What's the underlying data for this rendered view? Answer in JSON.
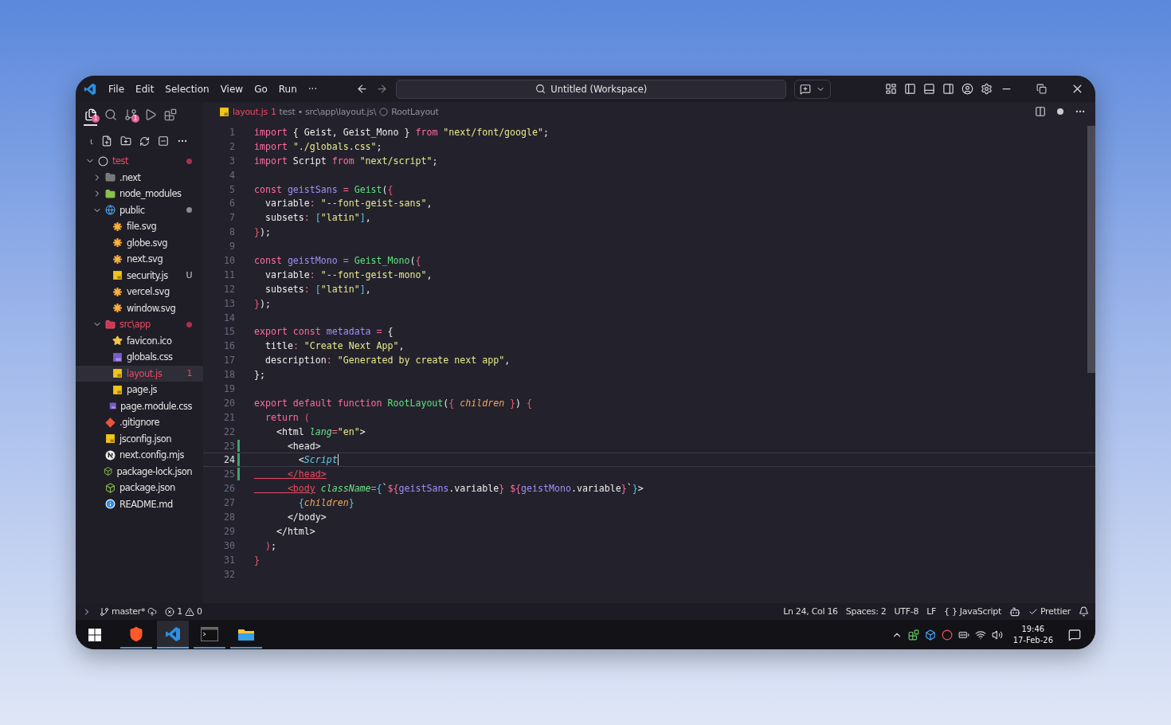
{
  "title_bar": {
    "menus": [
      "File",
      "Edit",
      "Selection",
      "View",
      "Go",
      "Run",
      "···"
    ],
    "search": "Untitled (Workspace)"
  },
  "activity": [
    {
      "kind": "explorer",
      "selected": true,
      "badge": "1"
    },
    {
      "kind": "search",
      "selected": false
    },
    {
      "kind": "source-control",
      "selected": false,
      "badge": "1"
    },
    {
      "kind": "run",
      "selected": false
    },
    {
      "kind": "extensions",
      "selected": false
    }
  ],
  "explorer_tools": {
    "collapse_mark": "ι"
  },
  "tree": [
    {
      "name": "test",
      "kind": "root",
      "error": true,
      "dot": true,
      "selected": false,
      "expanded": true,
      "children": [
        {
          "name": ".next",
          "kind": "folder-next",
          "error": false,
          "dot": false,
          "selected": false,
          "expanded": false
        },
        {
          "name": "node_modules",
          "kind": "folder-node",
          "error": false,
          "dot": false,
          "selected": false,
          "expanded": false
        },
        {
          "name": "public",
          "kind": "folder-public",
          "error": false,
          "dot": true,
          "selected": false,
          "expanded": true,
          "children": [
            {
              "name": "file.svg",
              "kind": "svg",
              "error": false,
              "dot": false,
              "selected": false
            },
            {
              "name": "globe.svg",
              "kind": "svg",
              "error": false,
              "dot": false,
              "selected": false
            },
            {
              "name": "next.svg",
              "kind": "svg",
              "error": false,
              "dot": false,
              "selected": false
            },
            {
              "name": "security.js",
              "kind": "js",
              "error": false,
              "dot": false,
              "selected": false,
              "badge": "U"
            },
            {
              "name": "vercel.svg",
              "kind": "svg",
              "error": false,
              "dot": false,
              "selected": false
            },
            {
              "name": "window.svg",
              "kind": "svg",
              "error": false,
              "dot": false,
              "selected": false
            }
          ]
        },
        {
          "name": "src\\app",
          "kind": "folder-src",
          "error": true,
          "dot": true,
          "selected": false,
          "expanded": true,
          "children": [
            {
              "name": "favicon.ico",
              "kind": "star",
              "error": false,
              "dot": false,
              "selected": false
            },
            {
              "name": "globals.css",
              "kind": "css",
              "error": false,
              "dot": false,
              "selected": false
            },
            {
              "name": "layout.js",
              "kind": "js",
              "error": true,
              "dot": false,
              "selected": true,
              "badge": "1"
            },
            {
              "name": "page.js",
              "kind": "js",
              "error": false,
              "dot": false,
              "selected": false
            },
            {
              "name": "page.module.css",
              "kind": "css",
              "error": false,
              "dot": false,
              "selected": false
            }
          ]
        },
        {
          "name": ".gitignore",
          "kind": "git",
          "error": false,
          "dot": false,
          "selected": false
        },
        {
          "name": "jsconfig.json",
          "kind": "jsconfig",
          "error": false,
          "dot": false,
          "selected": false
        },
        {
          "name": "next.config.mjs",
          "kind": "next",
          "error": false,
          "dot": false,
          "selected": false
        },
        {
          "name": "package-lock.json",
          "kind": "node",
          "error": false,
          "dot": false,
          "selected": false
        },
        {
          "name": "package.json",
          "kind": "node",
          "error": false,
          "dot": false,
          "selected": false
        },
        {
          "name": "README.md",
          "kind": "info",
          "error": false,
          "dot": false,
          "selected": false
        }
      ]
    }
  ],
  "editor": {
    "file": "layout.js",
    "problems": "1",
    "path": "test • src\\app\\layout.js\\",
    "symbol": "RootLayout",
    "dirty": true,
    "lines": [
      {
        "number": "1",
        "current": false,
        "changed": false,
        "tokens": [
          {
            "text": "import",
            "kind": "kw"
          },
          {
            "text": " { Geist, Geist_Mono } ",
            "kind": "plain"
          },
          {
            "text": "from ",
            "kind": "kw"
          },
          {
            "text": "\"next/font/google\"",
            "kind": "str"
          },
          {
            "text": ";",
            "kind": "plain"
          }
        ]
      },
      {
        "number": "2",
        "current": false,
        "changed": false,
        "tokens": [
          {
            "text": "import ",
            "kind": "kw"
          },
          {
            "text": "\"./globals.css\"",
            "kind": "str"
          },
          {
            "text": ";",
            "kind": "plain"
          }
        ]
      },
      {
        "number": "3",
        "current": false,
        "changed": false,
        "tokens": [
          {
            "text": "import",
            "kind": "kw"
          },
          {
            "text": " Script ",
            "kind": "plain"
          },
          {
            "text": "from ",
            "kind": "kw"
          },
          {
            "text": "\"next/script\"",
            "kind": "str"
          },
          {
            "text": ";",
            "kind": "plain"
          }
        ]
      },
      {
        "number": "4",
        "current": false,
        "changed": false
      },
      {
        "number": "5",
        "current": false,
        "changed": false,
        "tokens": [
          {
            "text": "const ",
            "kind": "kw"
          },
          {
            "text": "geistSans",
            "kind": "var"
          },
          {
            "text": " = ",
            "kind": "op"
          },
          {
            "text": "Geist",
            "kind": "fn"
          },
          {
            "text": "(",
            "kind": "plain"
          },
          {
            "text": "{",
            "kind": "brace"
          }
        ]
      },
      {
        "number": "6",
        "current": false,
        "changed": false,
        "tokens": [
          {
            "text": "  variable",
            "kind": "plain"
          },
          {
            "text": ": ",
            "kind": "op"
          },
          {
            "text": "\"--font-geist-sans\"",
            "kind": "str"
          },
          {
            "text": ",",
            "kind": "plain"
          }
        ]
      },
      {
        "number": "7",
        "current": false,
        "changed": false,
        "tokens": [
          {
            "text": "  subsets",
            "kind": "plain"
          },
          {
            "text": ": ",
            "kind": "op"
          },
          {
            "text": "[",
            "kind": "brace2"
          },
          {
            "text": "\"latin\"",
            "kind": "str"
          },
          {
            "text": "]",
            "kind": "brace2"
          },
          {
            "text": ",",
            "kind": "plain"
          }
        ]
      },
      {
        "number": "8",
        "current": false,
        "changed": false,
        "tokens": [
          {
            "text": "}",
            "kind": "brace"
          },
          {
            "text": ");",
            "kind": "plain"
          }
        ]
      },
      {
        "number": "9",
        "current": false,
        "changed": false
      },
      {
        "number": "10",
        "current": false,
        "changed": false,
        "tokens": [
          {
            "text": "const ",
            "kind": "kw"
          },
          {
            "text": "geistMono",
            "kind": "var"
          },
          {
            "text": " = ",
            "kind": "op"
          },
          {
            "text": "Geist_Mono",
            "kind": "fn"
          },
          {
            "text": "(",
            "kind": "plain"
          },
          {
            "text": "{",
            "kind": "brace"
          }
        ]
      },
      {
        "number": "11",
        "current": false,
        "changed": false,
        "tokens": [
          {
            "text": "  variable",
            "kind": "plain"
          },
          {
            "text": ": ",
            "kind": "op"
          },
          {
            "text": "\"--font-geist-mono\"",
            "kind": "str"
          },
          {
            "text": ",",
            "kind": "plain"
          }
        ]
      },
      {
        "number": "12",
        "current": false,
        "changed": false,
        "tokens": [
          {
            "text": "  subsets",
            "kind": "plain"
          },
          {
            "text": ": ",
            "kind": "op"
          },
          {
            "text": "[",
            "kind": "brace2"
          },
          {
            "text": "\"latin\"",
            "kind": "str"
          },
          {
            "text": "]",
            "kind": "brace2"
          },
          {
            "text": ",",
            "kind": "plain"
          }
        ]
      },
      {
        "number": "13",
        "current": false,
        "changed": false,
        "tokens": [
          {
            "text": "}",
            "kind": "brace"
          },
          {
            "text": ");",
            "kind": "plain"
          }
        ]
      },
      {
        "number": "14",
        "current": false,
        "changed": false
      },
      {
        "number": "15",
        "current": false,
        "changed": false,
        "tokens": [
          {
            "text": "export const ",
            "kind": "kw"
          },
          {
            "text": "metadata",
            "kind": "var"
          },
          {
            "text": " = ",
            "kind": "op"
          },
          {
            "text": "{",
            "kind": "plain"
          }
        ]
      },
      {
        "number": "16",
        "current": false,
        "changed": false,
        "tokens": [
          {
            "text": "  title",
            "kind": "plain"
          },
          {
            "text": ": ",
            "kind": "op"
          },
          {
            "text": "\"Create Next App\"",
            "kind": "str"
          },
          {
            "text": ",",
            "kind": "plain"
          }
        ]
      },
      {
        "number": "17",
        "current": false,
        "changed": false,
        "tokens": [
          {
            "text": "  description",
            "kind": "plain"
          },
          {
            "text": ": ",
            "kind": "op"
          },
          {
            "text": "\"Generated by create next app\"",
            "kind": "str"
          },
          {
            "text": ",",
            "kind": "plain"
          }
        ]
      },
      {
        "number": "18",
        "current": false,
        "changed": false,
        "tokens": [
          {
            "text": "};",
            "kind": "plain"
          }
        ]
      },
      {
        "number": "19",
        "current": false,
        "changed": false
      },
      {
        "number": "20",
        "current": false,
        "changed": false,
        "tokens": [
          {
            "text": "export default function ",
            "kind": "kw"
          },
          {
            "text": "RootLayout",
            "kind": "fn"
          },
          {
            "text": "(",
            "kind": "plain"
          },
          {
            "text": "{ ",
            "kind": "brace"
          },
          {
            "text": "children",
            "kind": "param"
          },
          {
            "text": " }",
            "kind": "brace"
          },
          {
            "text": ") ",
            "kind": "plain"
          },
          {
            "text": "{",
            "kind": "brace"
          }
        ]
      },
      {
        "number": "21",
        "current": false,
        "changed": false,
        "tokens": [
          {
            "text": "  return ",
            "kind": "kw"
          },
          {
            "text": "(",
            "kind": "brace"
          }
        ]
      },
      {
        "number": "22",
        "current": false,
        "changed": false,
        "tokens": [
          {
            "text": "    <html ",
            "kind": "plain"
          },
          {
            "text": "lang",
            "kind": "attr"
          },
          {
            "text": "=",
            "kind": "op"
          },
          {
            "text": "\"en\"",
            "kind": "str"
          },
          {
            "text": ">",
            "kind": "plain"
          }
        ]
      },
      {
        "number": "23",
        "current": false,
        "changed": true,
        "tokens": [
          {
            "text": "      <head>",
            "kind": "plain"
          }
        ]
      },
      {
        "number": "24",
        "current": true,
        "changed": true,
        "tokens": [
          {
            "text": "        <",
            "kind": "plain"
          },
          {
            "text": "Script",
            "kind": "comp"
          }
        ]
      },
      {
        "number": "25",
        "current": false,
        "changed": true,
        "tokens": [
          {
            "text": "      </head>",
            "kind": "err"
          }
        ]
      },
      {
        "number": "26",
        "current": false,
        "changed": false,
        "tokens": [
          {
            "text": "      <body",
            "kind": "err"
          },
          {
            "text": " className",
            "kind": "attr"
          },
          {
            "text": "=",
            "kind": "op"
          },
          {
            "text": "{",
            "kind": "brace2"
          },
          {
            "text": "`",
            "kind": "plain"
          },
          {
            "text": "${",
            "kind": "op"
          },
          {
            "text": "geistSans",
            "kind": "var"
          },
          {
            "text": ".variable",
            "kind": "plain"
          },
          {
            "text": "} ${",
            "kind": "op"
          },
          {
            "text": "geistMono",
            "kind": "var"
          },
          {
            "text": ".variable",
            "kind": "plain"
          },
          {
            "text": "}",
            "kind": "op"
          },
          {
            "text": "`",
            "kind": "plain"
          },
          {
            "text": "}",
            "kind": "brace2"
          },
          {
            "text": ">",
            "kind": "plain"
          }
        ]
      },
      {
        "number": "27",
        "current": false,
        "changed": false,
        "tokens": [
          {
            "text": "        {",
            "kind": "brace2"
          },
          {
            "text": "children",
            "kind": "param"
          },
          {
            "text": "}",
            "kind": "brace2"
          }
        ]
      },
      {
        "number": "28",
        "current": false,
        "changed": false,
        "tokens": [
          {
            "text": "      </body>",
            "kind": "plain"
          }
        ]
      },
      {
        "number": "29",
        "current": false,
        "changed": false,
        "tokens": [
          {
            "text": "    </html>",
            "kind": "plain"
          }
        ]
      },
      {
        "number": "30",
        "current": false,
        "changed": false,
        "tokens": [
          {
            "text": "  )",
            "kind": "brace"
          },
          {
            "text": ";",
            "kind": "plain"
          }
        ]
      },
      {
        "number": "31",
        "current": false,
        "changed": false,
        "tokens": [
          {
            "text": "}",
            "kind": "brace"
          }
        ]
      },
      {
        "number": "32",
        "current": false,
        "changed": false
      }
    ]
  },
  "status_bar": {
    "branch": "master*",
    "errors": "1",
    "warnings": "0",
    "position": "Ln 24, Col 16",
    "indent": "Spaces: 2",
    "encoding": "UTF-8",
    "eol": "LF",
    "language": "{ } JavaScript",
    "formatter": "Prettier"
  },
  "taskbar": {
    "apps": [
      {
        "kind": "brave",
        "selected": false
      },
      {
        "kind": "vscode",
        "selected": true
      },
      {
        "kind": "terminal",
        "selected": false
      },
      {
        "kind": "files",
        "selected": false
      }
    ],
    "time": "19:46",
    "date": "17-Feb-26"
  }
}
